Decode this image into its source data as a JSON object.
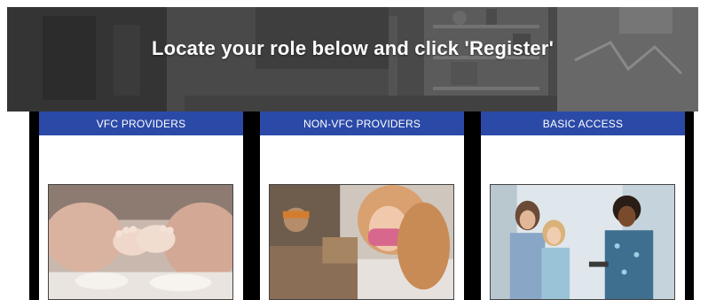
{
  "hero": {
    "title": "Locate your role below and click 'Register'"
  },
  "cards": [
    {
      "heading": "VFC PROVIDERS",
      "image": "baby-feet-in-hands-photo"
    },
    {
      "heading": "NON-VFC PROVIDERS",
      "image": "masked-person-photo"
    },
    {
      "heading": "BASIC ACCESS",
      "image": "nurse-with-family-photo"
    }
  ],
  "colors": {
    "header_blue": "#2b4aa8",
    "card_gutter": "#000000",
    "hero_overlay": "#4d4d4d"
  }
}
